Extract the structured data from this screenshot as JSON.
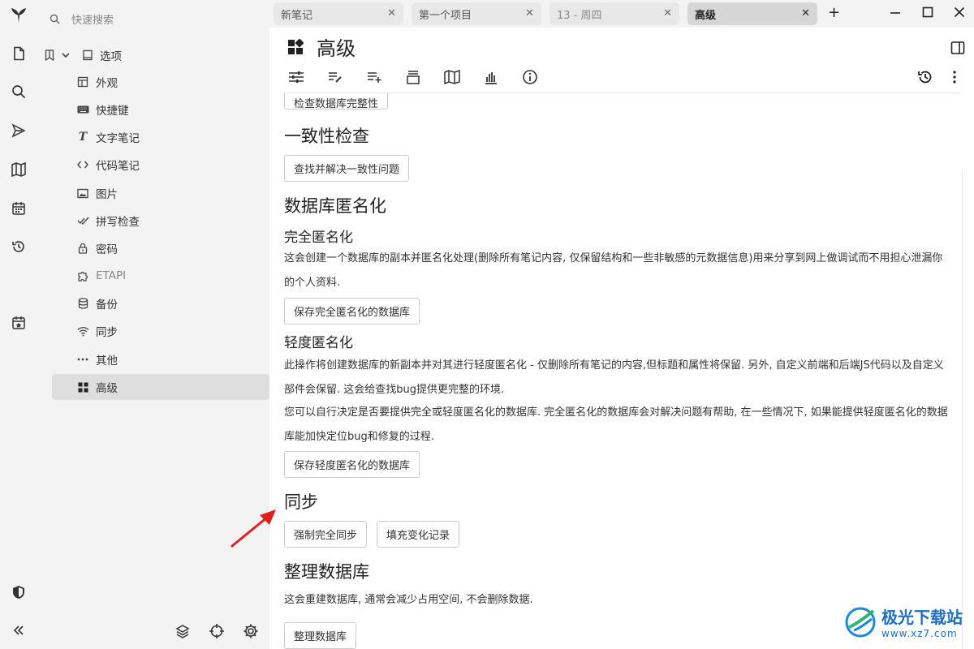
{
  "sidebar": {
    "search_placeholder": "快速搜索",
    "root_label": "选项"
  },
  "items": [
    {
      "label": "外观",
      "icon": "layout-icon"
    },
    {
      "label": "快捷键",
      "icon": "keyboard-icon"
    },
    {
      "label": "文字笔记",
      "icon": "text-icon"
    },
    {
      "label": "代码笔记",
      "icon": "code-icon"
    },
    {
      "label": "图片",
      "icon": "image-icon"
    },
    {
      "label": "拼写检查",
      "icon": "check-icon"
    },
    {
      "label": "密码",
      "icon": "lock-icon"
    },
    {
      "label": "ETAPI",
      "icon": "puzzle-icon"
    },
    {
      "label": "备份",
      "icon": "database-icon"
    },
    {
      "label": "同步",
      "icon": "wifi-icon"
    },
    {
      "label": "其他",
      "icon": "dots-icon"
    },
    {
      "label": "高级",
      "icon": "grid-icon"
    }
  ],
  "tabs": [
    {
      "label": "新笔记"
    },
    {
      "label": "第一个项目"
    },
    {
      "label": "13 - 周四"
    },
    {
      "label": "高级"
    }
  ],
  "note": {
    "title": "高级"
  },
  "content": {
    "cut_button": "检查数据库完整性",
    "consistency_heading": "一致性检查",
    "consistency_button": "查找并解决一致性问题",
    "anon_heading": "数据库匿名化",
    "full_heading": "完全匿名化",
    "full_text": "这会创建一个数据库的副本并匿名化处理(删除所有笔记内容, 仅保留结构和一些非敏感的元数据信息)用来分享到网上做调试而不用担心泄漏你的个人资料.",
    "full_button": "保存完全匿名化的数据库",
    "light_heading": "轻度匿名化",
    "light_text": "此操作将创建数据库的新副本并对其进行轻度匿名化 - 仅删除所有笔记的内容,但标题和属性将保留. 另外, 自定义前端和后端JS代码以及自定义部件会保留. 这会给查找bug提供更完整的环境.",
    "choose_text": "您可以自行决定是否要提供完全或轻度匿名化的数据库. 完全匿名化的数据库会对解决问题有帮助, 在一些情况下, 如果能提供轻度匿名化的数据库能加快定位bug和修复的过程.",
    "light_button": "保存轻度匿名化的数据库",
    "sync_heading": "同步",
    "force_sync_button": "强制完全同步",
    "fill_changes_button": "填充变化记录",
    "vacuum_heading": "整理数据库",
    "vacuum_text": "这会重建数据库, 通常会减少占用空间, 不会删除数据.",
    "vacuum_button": "整理数据库"
  },
  "watermark": {
    "title": "极光下载站",
    "url": "www.xz7.com"
  },
  "colors": {
    "arrow": "#e02020",
    "active_item": "#dedede",
    "sidebar_bg": "#f3f3f3"
  }
}
